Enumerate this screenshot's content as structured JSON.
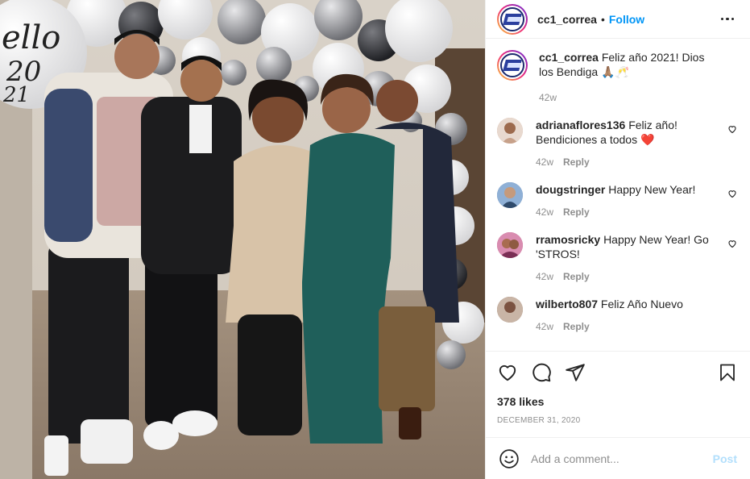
{
  "header": {
    "username": "cc1_correa",
    "separator": "•",
    "follow_label": "Follow"
  },
  "caption": {
    "username": "cc1_correa",
    "text": "Feliz año 2021! Dios los Bendiga 🙏🏽🥂",
    "age": "42w"
  },
  "comments": [
    {
      "username": "adrianaflores136",
      "text": "Feliz año! Bendiciones a todos ❤️",
      "age": "42w",
      "reply_label": "Reply",
      "avatar_color": "#c9a38c"
    },
    {
      "username": "dougstringer",
      "text": "Happy New Year!",
      "age": "42w",
      "reply_label": "Reply",
      "avatar_color": "#5b7fa8"
    },
    {
      "username": "rramosricky",
      "text": "Happy New Year! Go 'STROS!",
      "age": "42w",
      "reply_label": "Reply",
      "avatar_color": "#b04a7a"
    },
    {
      "username": "wilberto807",
      "text": "Feliz Año Nuevo",
      "age": "42w",
      "reply_label": "Reply",
      "avatar_color": "#8a6f5d"
    }
  ],
  "photo": {
    "balloon_text": "ello 2021"
  },
  "actions": {
    "icons": [
      "heart-icon",
      "comment-icon",
      "share-icon",
      "bookmark-icon"
    ],
    "likes": "378 likes",
    "date": "DECEMBER 31, 2020"
  },
  "add_comment": {
    "emoji_icon": "smiley-icon",
    "placeholder": "Add a comment...",
    "post_label": "Post"
  },
  "colors": {
    "link_blue": "#0095f6",
    "post_disabled": "#b2dffc",
    "heart_red": "#ed4956",
    "muted": "#8e8e8e"
  }
}
